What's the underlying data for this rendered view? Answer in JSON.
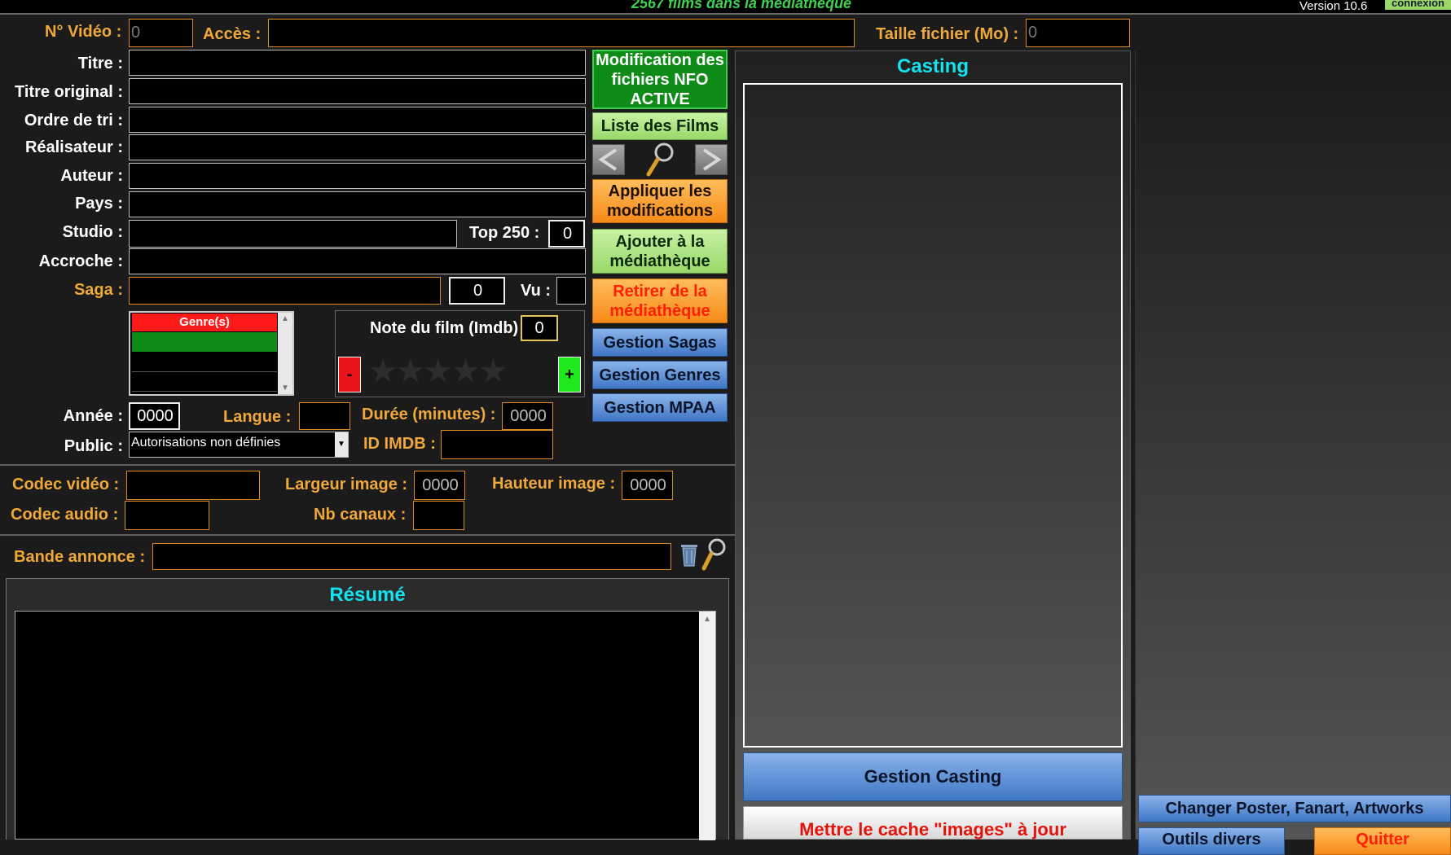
{
  "topbar": {
    "count": "2567 films dans la médiathèque",
    "version": "Version 10.6",
    "connexion": "connexion"
  },
  "labels": {
    "video_no": "N° Vidéo :",
    "acces": "Accès :",
    "taille": "Taille fichier (Mo) :",
    "titre": "Titre :",
    "titre_original": "Titre original :",
    "ordre_tri": "Ordre de tri :",
    "realisateur": "Réalisateur :",
    "auteur": "Auteur :",
    "pays": "Pays :",
    "studio": "Studio :",
    "top250": "Top 250 :",
    "accroche": "Accroche :",
    "saga": "Saga :",
    "vu": "Vu :",
    "annee": "Année :",
    "langue": "Langue :",
    "duree": "Durée (minutes) :",
    "public": "Public :",
    "id_imdb": "ID IMDB :",
    "codec_video": "Codec vidéo :",
    "codec_audio": "Codec audio :",
    "largeur": "Largeur image :",
    "hauteur": "Hauteur image :",
    "nb_canaux": "Nb canaux :",
    "bande_annonce": "Bande annonce :",
    "note": "Note du film (Imdb)"
  },
  "values": {
    "video_no": "0",
    "taille": "0",
    "top250": "0",
    "saga_no": "0",
    "note": "0",
    "annee": "0000",
    "duree": "0000",
    "largeur": "0000",
    "hauteur": "0000",
    "public": "Autorisations non définies"
  },
  "genres": {
    "header": "Genre(s)"
  },
  "rating": {
    "minus": "-",
    "plus": "+",
    "stars": 0,
    "max_stars": 5
  },
  "buttons": {
    "nfo": "Modification des fichiers NFO ACTIVE",
    "liste": "Liste des Films",
    "prev": "<",
    "next": ">",
    "appliquer": "Appliquer les modifications",
    "ajouter": "Ajouter à la médiathèque",
    "retirer": "Retirer de la médiathèque",
    "sagas": "Gestion Sagas",
    "genres": "Gestion Genres",
    "mpaa": "Gestion MPAA",
    "casting": "Gestion Casting",
    "cache": "Mettre le cache \"images\" à jour",
    "poster": "Changer Poster, Fanart, Artworks",
    "outils": "Outils divers",
    "quitter": "Quitter"
  },
  "panels": {
    "casting": "Casting",
    "resume": "Résumé"
  },
  "colors": {
    "accent_cyan": "#12e3ee",
    "label_orange": "#f0a838",
    "title_green": "#3fd052"
  }
}
